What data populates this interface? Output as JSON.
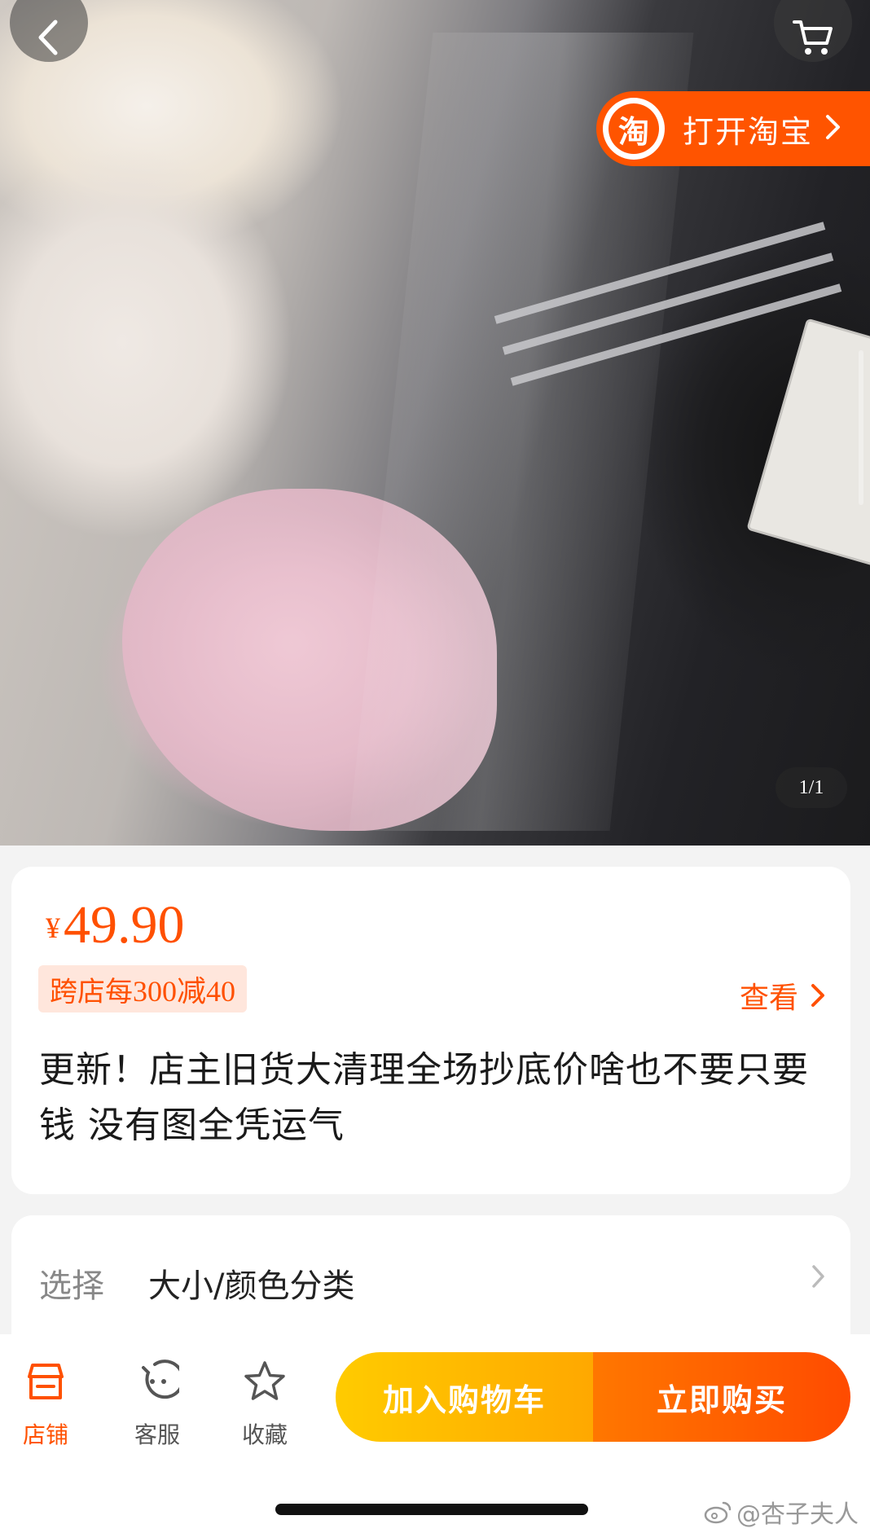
{
  "gallery": {
    "counter": "1/1",
    "open_app_label": "打开淘宝",
    "app_logo_char": "淘"
  },
  "product": {
    "currency": "¥",
    "price": "49.90",
    "promo_prefix": "跨店每",
    "promo_number": "300减40",
    "view_label": "查看",
    "title": "更新！店主旧货大清理全场抄底价啥也不要只要钱 没有图全凭运气"
  },
  "options": {
    "label": "选择",
    "value": "大小/颜色分类"
  },
  "bottom_bar": {
    "shop_label": "店铺",
    "service_label": "客服",
    "favorite_label": "收藏",
    "add_to_cart_label": "加入购物车",
    "buy_now_label": "立即购买"
  },
  "watermark": "@杏子夫人",
  "colors": {
    "accent": "#ff5000",
    "cart_button": "#ffb300",
    "buy_button": "#ff5a00"
  },
  "icons": [
    "back-arrow-icon",
    "cart-icon",
    "taobao-logo-icon",
    "chevron-right-icon",
    "shop-icon",
    "customer-service-icon",
    "star-icon",
    "weibo-icon"
  ]
}
